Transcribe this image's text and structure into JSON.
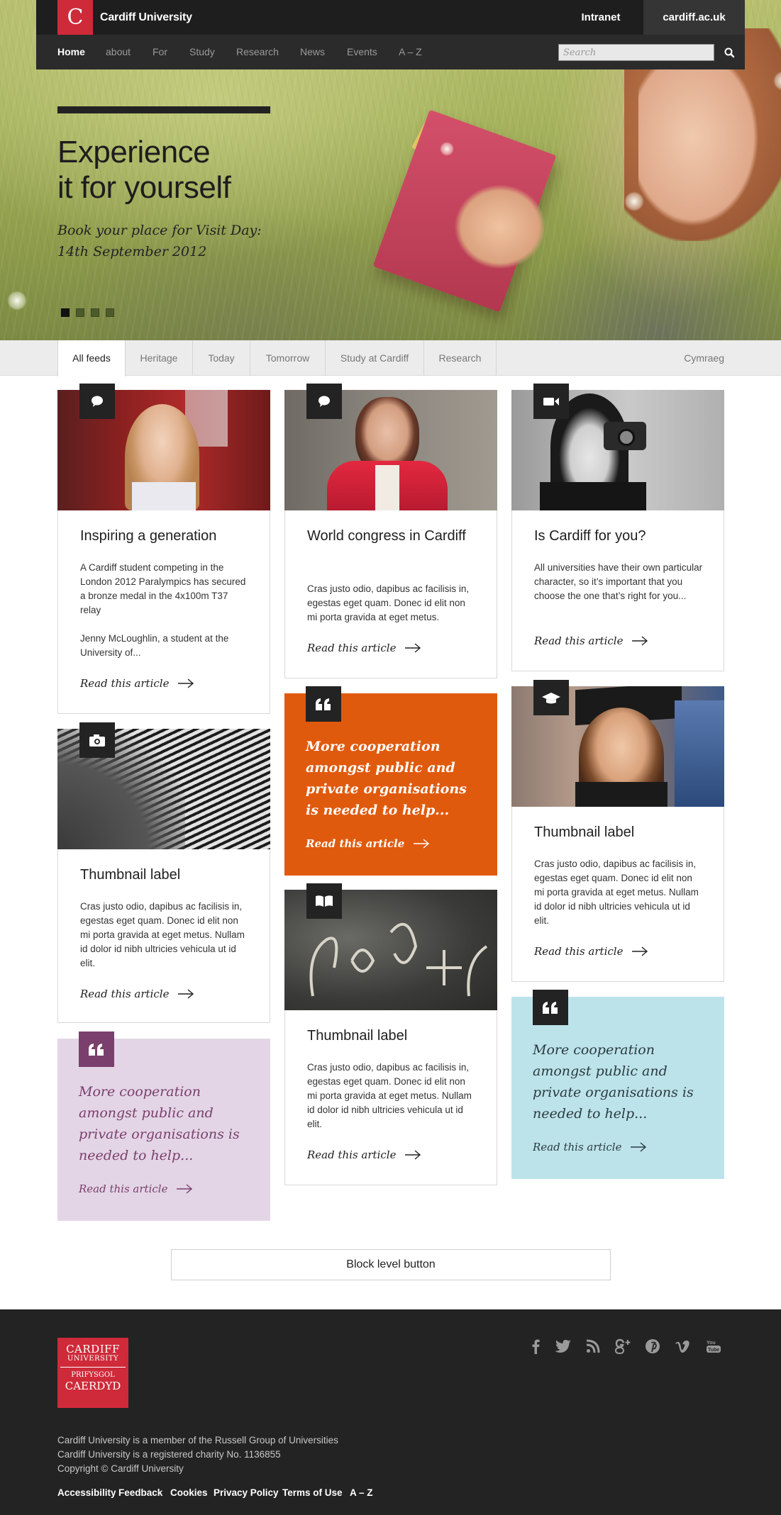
{
  "header": {
    "logo_letter": "C",
    "site_name": "Cardiff University",
    "top_links": [
      "Intranet",
      "cardiff.ac.uk"
    ]
  },
  "nav": {
    "items": [
      "Home",
      "about",
      "For",
      "Study",
      "Research",
      "News",
      "Events",
      "A – Z"
    ],
    "active": "Home",
    "search_placeholder": "Search",
    "search_icon": "search-icon"
  },
  "hero": {
    "title_line1": "Experience",
    "title_line2": "it for yourself",
    "subtitle_line1": "Book your place for Visit Day:",
    "subtitle_line2": "14th September 2012",
    "slides": 4,
    "active_slide": 1
  },
  "filters": {
    "tabs": [
      "All feeds",
      "Heritage",
      "Today",
      "Tomorrow",
      "Study at Cardiff",
      "Research"
    ],
    "active": "All feeds",
    "language": "Cymraeg"
  },
  "cards": [
    {
      "icon": "comment-icon",
      "title": "Inspiring a generation",
      "text1": "A Cardiff student competing in the London 2012 Paralympics has secured a bronze medal in the 4x100m T37 relay",
      "text2": "Jenny McLoughlin, a student at the University of...",
      "read": "Read this article"
    },
    {
      "icon": "comment-icon",
      "title": "World congress in Cardiff",
      "text1": "Cras justo odio, dapibus ac facilisis in, egestas eget quam. Donec id elit non mi porta gravida at eget metus.",
      "read": "Read this article"
    },
    {
      "icon": "video-camera-icon",
      "title": "Is Cardiff for you?",
      "text1": "All universities have their own particular character, so it’s important that you choose the one that’s right for you...",
      "read": "Read this article"
    },
    {
      "icon": "camera-icon",
      "title": "Thumbnail label",
      "text1": "Cras justo odio, dapibus ac facilisis in, egestas eget quam. Donec id elit non mi porta gravida at eget metus. Nullam id dolor id nibh ultricies vehicula ut id elit.",
      "read": "Read this article"
    },
    {
      "icon": "book-icon",
      "title": "Thumbnail label",
      "text1": "Cras justo odio, dapibus ac facilisis in, egestas eget quam. Donec id elit non mi porta gravida at eget metus. Nullam id dolor id nibh ultricies vehicula ut id elit.",
      "read": "Read this article"
    },
    {
      "icon": "graduation-cap-icon",
      "title": "Thumbnail label",
      "text1": "Cras justo odio, dapibus ac facilisis in, egestas eget quam. Donec id elit non mi porta gravida at eget metus. Nullam id dolor id nibh ultricies vehicula ut id elit.",
      "read": "Read this article"
    }
  ],
  "quotes": [
    {
      "icon": "quote-icon",
      "text": "More cooperation amongst public and private organisations is needed to help...",
      "read": "Read this article",
      "bg": "#e05a0d",
      "badge": "#232323",
      "color": "#ffffff"
    },
    {
      "icon": "quote-icon",
      "text": "More cooperation amongst public and private organisations is needed to help...",
      "read": "Read this article",
      "bg": "#e3d5e6",
      "badge": "#7a3f6d",
      "color": "#7a3f6d"
    },
    {
      "icon": "quote-icon",
      "text": "More cooperation amongst public and private organisations is needed to help...",
      "read": "Read this article",
      "bg": "#bde3ea",
      "badge": "#232323",
      "color": "#2a3a3f"
    }
  ],
  "block_button": "Block level button",
  "footer": {
    "logo_lines": [
      "CARDIFF",
      "UNIVERSITY",
      "PRIFYSGOL",
      "CAERDYD"
    ],
    "social_icons": [
      "facebook-icon",
      "twitter-icon",
      "rss-icon",
      "google-plus-icon",
      "pinterest-icon",
      "vimeo-icon",
      "youtube-icon"
    ],
    "lines": [
      "Cardiff University is a member of the Russell Group of Universities",
      "Cardiff University is a registered charity No. 1136855",
      "Copyright © Cardiff University"
    ],
    "links": [
      "Accessibility",
      "Feedback",
      "Cookies",
      "Privacy Policy",
      "Terms of Use",
      "A – Z"
    ]
  }
}
